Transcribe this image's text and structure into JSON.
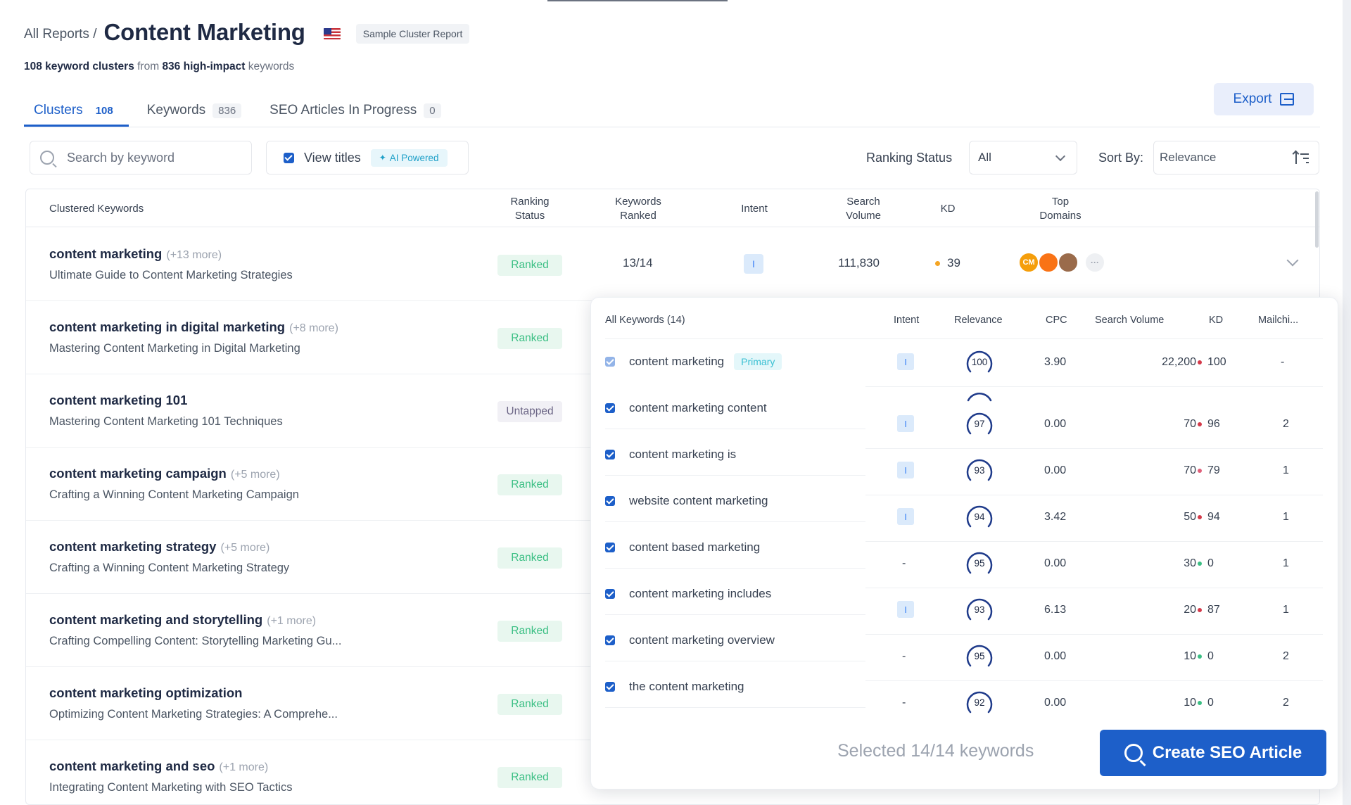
{
  "header": {
    "breadcrumb": "All Reports /",
    "title": "Content Marketing",
    "flag_icon": "us-flag-icon",
    "sample_badge": "Sample Cluster Report",
    "subtitle": {
      "clusters": "108 keyword clusters",
      "from": "from",
      "keywords": "836 high-impact",
      "suffix": "keywords"
    }
  },
  "tabs": [
    {
      "label": "Clusters",
      "count": "108",
      "active": true
    },
    {
      "label": "Keywords",
      "count": "836",
      "active": false
    },
    {
      "label": "SEO Articles In Progress",
      "count": "0",
      "active": false
    }
  ],
  "export_label": "Export",
  "filters": {
    "search_placeholder": "Search by keyword",
    "view_titles_label": "View titles",
    "ai_badge": "AI Powered",
    "ranking_label": "Ranking Status",
    "ranking_value": "All",
    "sort_label": "Sort By:",
    "sort_value": "Relevance"
  },
  "table": {
    "headers": {
      "clustered": "Clustered Keywords",
      "ranking_status": [
        "Ranking",
        "Status"
      ],
      "keywords_ranked": [
        "Keywords",
        "Ranked"
      ],
      "intent": "Intent",
      "search_volume": [
        "Search",
        "Volume"
      ],
      "kd": "KD",
      "top_domains": [
        "Top",
        "Domains"
      ]
    },
    "rows": [
      {
        "keyword": "content marketing",
        "more": "(+13 more)",
        "title": "Ultimate Guide to Content Marketing Strategies",
        "status": "Ranked",
        "keywords_ranked": "13/14",
        "intent": "I",
        "search_volume": "111,830",
        "kd": "39"
      },
      {
        "keyword": "content marketing in digital marketing",
        "more": "(+8 more)",
        "title": "Mastering Content Marketing in Digital Marketing",
        "status": "Ranked"
      },
      {
        "keyword": "content marketing 101",
        "more": "",
        "title": "Mastering Content Marketing 101 Techniques",
        "status": "Untapped"
      },
      {
        "keyword": "content marketing campaign",
        "more": "(+5 more)",
        "title": "Crafting a Winning Content Marketing Campaign",
        "status": "Ranked"
      },
      {
        "keyword": "content marketing strategy",
        "more": "(+5 more)",
        "title": "Crafting a Winning Content Marketing Strategy",
        "status": "Ranked"
      },
      {
        "keyword": "content marketing and storytelling",
        "more": "(+1 more)",
        "title": "Crafting Compelling Content: Storytelling Marketing Gu...",
        "status": "Ranked"
      },
      {
        "keyword": "content marketing optimization",
        "more": "",
        "title": "Optimizing Content Marketing Strategies: A Comprehe...",
        "status": "Ranked"
      },
      {
        "keyword": "content marketing and seo",
        "more": "(+1 more)",
        "title": "Integrating Content Marketing with SEO Tactics",
        "status": "Ranked"
      }
    ],
    "domain_labels": [
      "CM",
      "",
      ""
    ],
    "domains_more": "···"
  },
  "panel": {
    "headers": {
      "all_keywords": "All Keywords (14)",
      "intent": "Intent",
      "relevance": "Relevance",
      "cpc": "CPC",
      "search_volume": "Search Volume",
      "kd": "KD",
      "mailchimp": "Mailchi..."
    },
    "primary_badge": "Primary",
    "keywords": [
      "content marketing",
      "content marketing content",
      "content marketing is",
      "website content marketing",
      "content based marketing",
      "content marketing includes",
      "content marketing overview",
      "the content marketing"
    ],
    "rows": [
      {
        "intent": "I",
        "relevance": "100",
        "cpc": "3.90",
        "volume": "22,200",
        "kd": "100",
        "kd_color": "#d43a4a",
        "mailchimp": "-"
      },
      {
        "intent": "I",
        "relevance": "97",
        "cpc": "0.00",
        "volume": "70",
        "kd": "96",
        "kd_color": "#d43a4a",
        "mailchimp": "2"
      },
      {
        "intent": "I",
        "relevance": "93",
        "cpc": "0.00",
        "volume": "70",
        "kd": "79",
        "kd_color": "#e0607a",
        "mailchimp": "1"
      },
      {
        "intent": "I",
        "relevance": "94",
        "cpc": "3.42",
        "volume": "50",
        "kd": "94",
        "kd_color": "#d43a4a",
        "mailchimp": "1"
      },
      {
        "intent": "-",
        "relevance": "95",
        "cpc": "0.00",
        "volume": "30",
        "kd": "0",
        "kd_color": "#3bbf84",
        "mailchimp": "1"
      },
      {
        "intent": "I",
        "relevance": "93",
        "cpc": "6.13",
        "volume": "20",
        "kd": "87",
        "kd_color": "#d43a4a",
        "mailchimp": "1"
      },
      {
        "intent": "-",
        "relevance": "95",
        "cpc": "0.00",
        "volume": "10",
        "kd": "0",
        "kd_color": "#3bbf84",
        "mailchimp": "2"
      },
      {
        "intent": "-",
        "relevance": "92",
        "cpc": "0.00",
        "volume": "10",
        "kd": "0",
        "kd_color": "#3bbf84",
        "mailchimp": "2"
      }
    ],
    "selected_text": "Selected 14/14 keywords",
    "create_button": "Create SEO Article"
  },
  "colors": {
    "accent": "#1d5fc9",
    "ranked": "#3bbf84",
    "kd_orange": "#f5a524"
  }
}
